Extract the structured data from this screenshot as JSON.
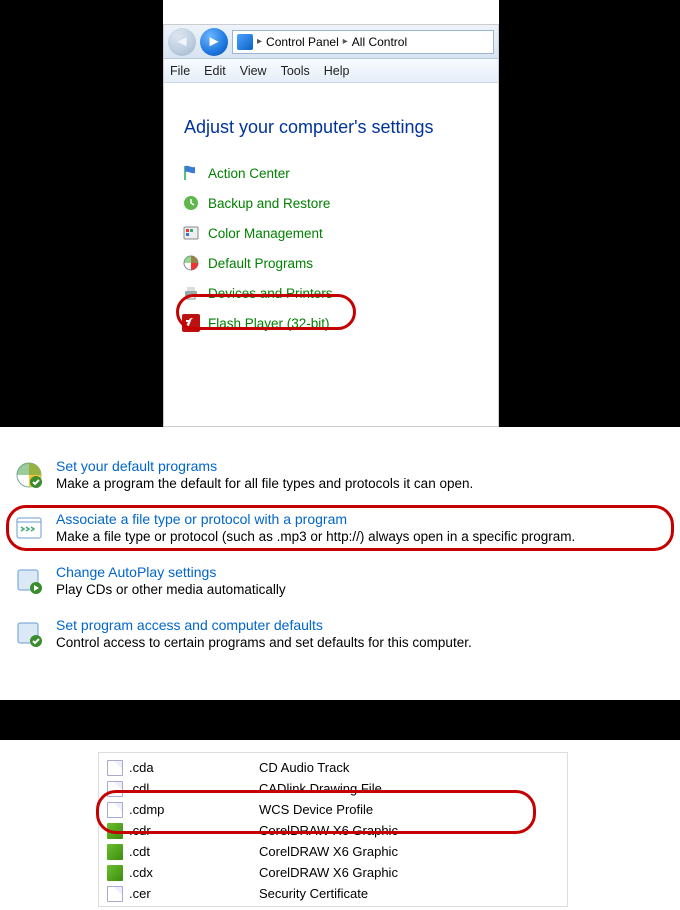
{
  "nav": {
    "crumb1": "Control Panel",
    "crumb2": "All Control"
  },
  "menus": [
    "File",
    "Edit",
    "View",
    "Tools",
    "Help"
  ],
  "heading": "Adjust your computer's settings",
  "items": [
    {
      "label": "Action Center",
      "icon": "flag"
    },
    {
      "label": "Backup and Restore",
      "icon": "backup"
    },
    {
      "label": "Color Management",
      "icon": "color"
    },
    {
      "label": "Default Programs",
      "icon": "default"
    },
    {
      "label": "Devices and Printers",
      "icon": "printer"
    },
    {
      "label": "Flash Player (32-bit)",
      "icon": "flash"
    }
  ],
  "options": [
    {
      "title": "Set your default programs",
      "desc": "Make a program the default for all file types and protocols it can open."
    },
    {
      "title": "Associate a file type or protocol with a program",
      "desc": "Make a file type or protocol (such as .mp3 or http://) always open in a specific program."
    },
    {
      "title": "Change AutoPlay settings",
      "desc": "Play CDs or other media automatically"
    },
    {
      "title": "Set program access and computer defaults",
      "desc": "Control access to certain programs and set defaults for this computer."
    }
  ],
  "filerows": [
    {
      "ext": ".cda",
      "desc": "CD Audio Track",
      "icon": "page"
    },
    {
      "ext": ".cdl",
      "desc": "CADlink Drawing File",
      "icon": "page"
    },
    {
      "ext": ".cdmp",
      "desc": "WCS Device Profile",
      "icon": "page"
    },
    {
      "ext": ".cdr",
      "desc": "CorelDRAW X6 Graphic",
      "icon": "cdraw"
    },
    {
      "ext": ".cdt",
      "desc": "CorelDRAW X6 Graphic",
      "icon": "cdraw"
    },
    {
      "ext": ".cdx",
      "desc": "CorelDRAW X6 Graphic",
      "icon": "cdraw"
    },
    {
      "ext": ".cer",
      "desc": "Security Certificate",
      "icon": "page"
    }
  ]
}
